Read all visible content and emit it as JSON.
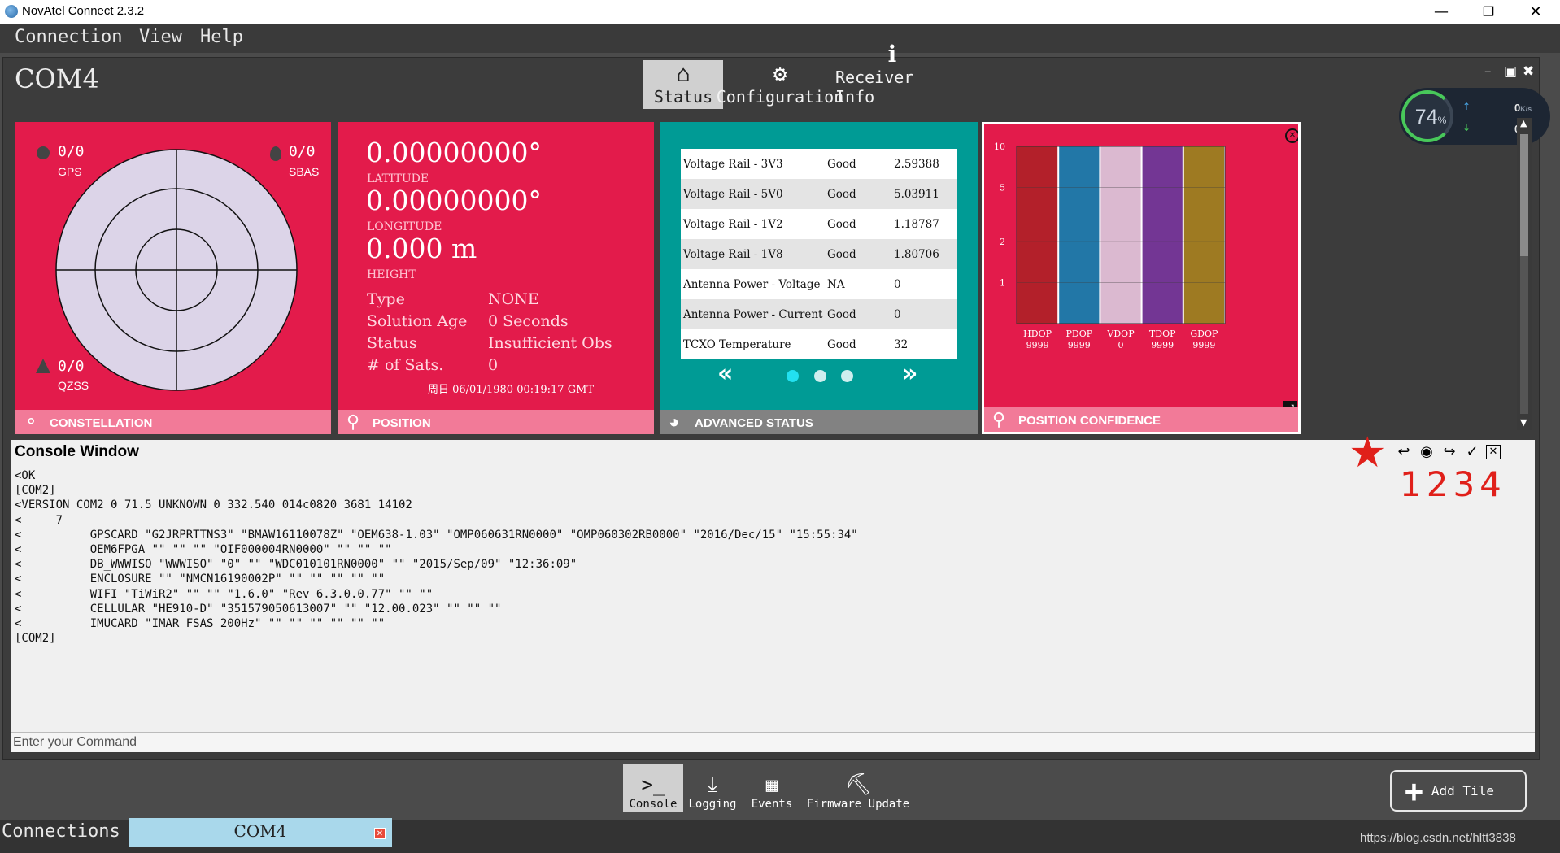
{
  "window": {
    "title": "NovAtel Connect 2.3.2",
    "minimize": "—",
    "restore": "❐",
    "close": "✕"
  },
  "menu": {
    "items": [
      "Connection",
      "View",
      "Help"
    ]
  },
  "workspace": {
    "title": "COM4",
    "tabs": [
      {
        "label": "Status",
        "icon": "home-icon",
        "active": true
      },
      {
        "label": "Configuration",
        "icon": "gear-icon",
        "active": false
      },
      {
        "label": "Receiver Info",
        "icon": "info-icon",
        "active": false
      }
    ],
    "controls": {
      "minimize": "–",
      "maximize": "▣",
      "close": "✖"
    }
  },
  "speed_widget": {
    "percent": "74",
    "percent_unit": "%",
    "upload": "0",
    "download": "0",
    "unit": "K/s"
  },
  "tiles": {
    "constellation": {
      "footer": "CONSTELLATION",
      "gps": {
        "count": "0/0",
        "label": "GPS"
      },
      "sbas": {
        "count": "0/0",
        "label": "SBAS"
      },
      "qzss": {
        "count": "0/0",
        "label": "QZSS"
      }
    },
    "position": {
      "footer": "POSITION",
      "latitude": "0.00000000°",
      "latitude_label": "LATITUDE",
      "longitude": "0.00000000°",
      "longitude_label": "LONGITUDE",
      "height": "0.000 m",
      "height_label": "HEIGHT",
      "rows": [
        {
          "label": "Type",
          "value": "NONE"
        },
        {
          "label": "Solution Age",
          "value": "0 Seconds"
        },
        {
          "label": "Status",
          "value": "Insufficient Obs"
        },
        {
          "label": "# of Sats.",
          "value": "0"
        }
      ],
      "timestamp": "周日 06/01/1980 00:19:17 GMT"
    },
    "advanced_status": {
      "footer": "ADVANCED STATUS",
      "rows": [
        {
          "name": "Voltage Rail - 3V3",
          "status": "Good",
          "value": "2.59388"
        },
        {
          "name": "Voltage Rail - 5V0",
          "status": "Good",
          "value": "5.03911"
        },
        {
          "name": "Voltage Rail - 1V2",
          "status": "Good",
          "value": "1.18787"
        },
        {
          "name": "Voltage Rail - 1V8",
          "status": "Good",
          "value": "1.80706"
        },
        {
          "name": "Antenna Power - Voltage",
          "status": "NA",
          "value": "0"
        },
        {
          "name": "Antenna Power - Current",
          "status": "Good",
          "value": "0"
        },
        {
          "name": "TCXO Temperature",
          "status": "Good",
          "value": "32"
        }
      ],
      "prev": "«",
      "next": "»",
      "page_count": 3,
      "active_page": 1
    },
    "position_confidence": {
      "footer": "POSITION CONFIDENCE",
      "y_ticks": [
        "10",
        "5",
        "2",
        "1"
      ],
      "colors": {
        "HDOP": "#b3202a",
        "PDOP": "#2277a7",
        "VDOP": "#dbb9d0",
        "TDOP": "#733694",
        "GDOP": "#9e7a22"
      }
    }
  },
  "chart_data": {
    "type": "bar",
    "categories": [
      "HDOP",
      "PDOP",
      "VDOP",
      "TDOP",
      "GDOP"
    ],
    "value_labels": [
      "9999",
      "9999",
      "0",
      "9999",
      "9999"
    ],
    "values": [
      9999,
      9999,
      0,
      9999,
      9999
    ],
    "yscale": "log",
    "ylim": [
      0.5,
      10
    ],
    "grid": true,
    "y_ticks": [
      10,
      5,
      2,
      1
    ]
  },
  "console": {
    "title": "Console Window",
    "lines": [
      "<OK",
      "[COM2]",
      "<VERSION COM2 0 71.5 UNKNOWN 0 332.540 014c0820 3681 14102",
      "<     7",
      "<          GPSCARD \"G2JRPRTTNS3\" \"BMAW16110078Z\" \"OEM638-1.03\" \"OMP060631RN0000\" \"OMP060302RB0000\" \"2016/Dec/15\" \"15:55:34\"",
      "<          OEM6FPGA \"\" \"\" \"\" \"OIF000004RN0000\" \"\" \"\" \"\"",
      "<          DB_WWWISO \"WWWISO\" \"0\" \"\" \"WDC010101RN0000\" \"\" \"2015/Sep/09\" \"12:36:09\"",
      "<          ENCLOSURE \"\" \"NMCN16190002P\" \"\" \"\" \"\" \"\" \"\"",
      "<          WIFI \"TiWiR2\" \"\" \"\" \"1.6.0\" \"Rev 6.3.0.0.77\" \"\" \"\"",
      "<          CELLULAR \"HE910-D\" \"351579050613007\" \"\" \"12.00.023\" \"\" \"\" \"\"",
      "<          IMUCARD \"IMAR FSAS 200Hz\" \"\" \"\" \"\" \"\" \"\" \"\"",
      "[COM2]"
    ],
    "command_placeholder": "Enter your Command",
    "annotation_numbers": "1234"
  },
  "bottom_tools": [
    {
      "label": "Console",
      "icon": "terminal-icon",
      "active": true
    },
    {
      "label": "Logging",
      "icon": "download-icon",
      "active": false
    },
    {
      "label": "Events",
      "icon": "calendar-icon",
      "active": false
    },
    {
      "label": "Firmware Update",
      "icon": "firmware-icon",
      "active": false
    }
  ],
  "add_tile": {
    "label": "Add Tile"
  },
  "connections": {
    "label": "Connections",
    "tab": "COM4"
  },
  "watermark": "https://blog.csdn.net/hltt3838"
}
